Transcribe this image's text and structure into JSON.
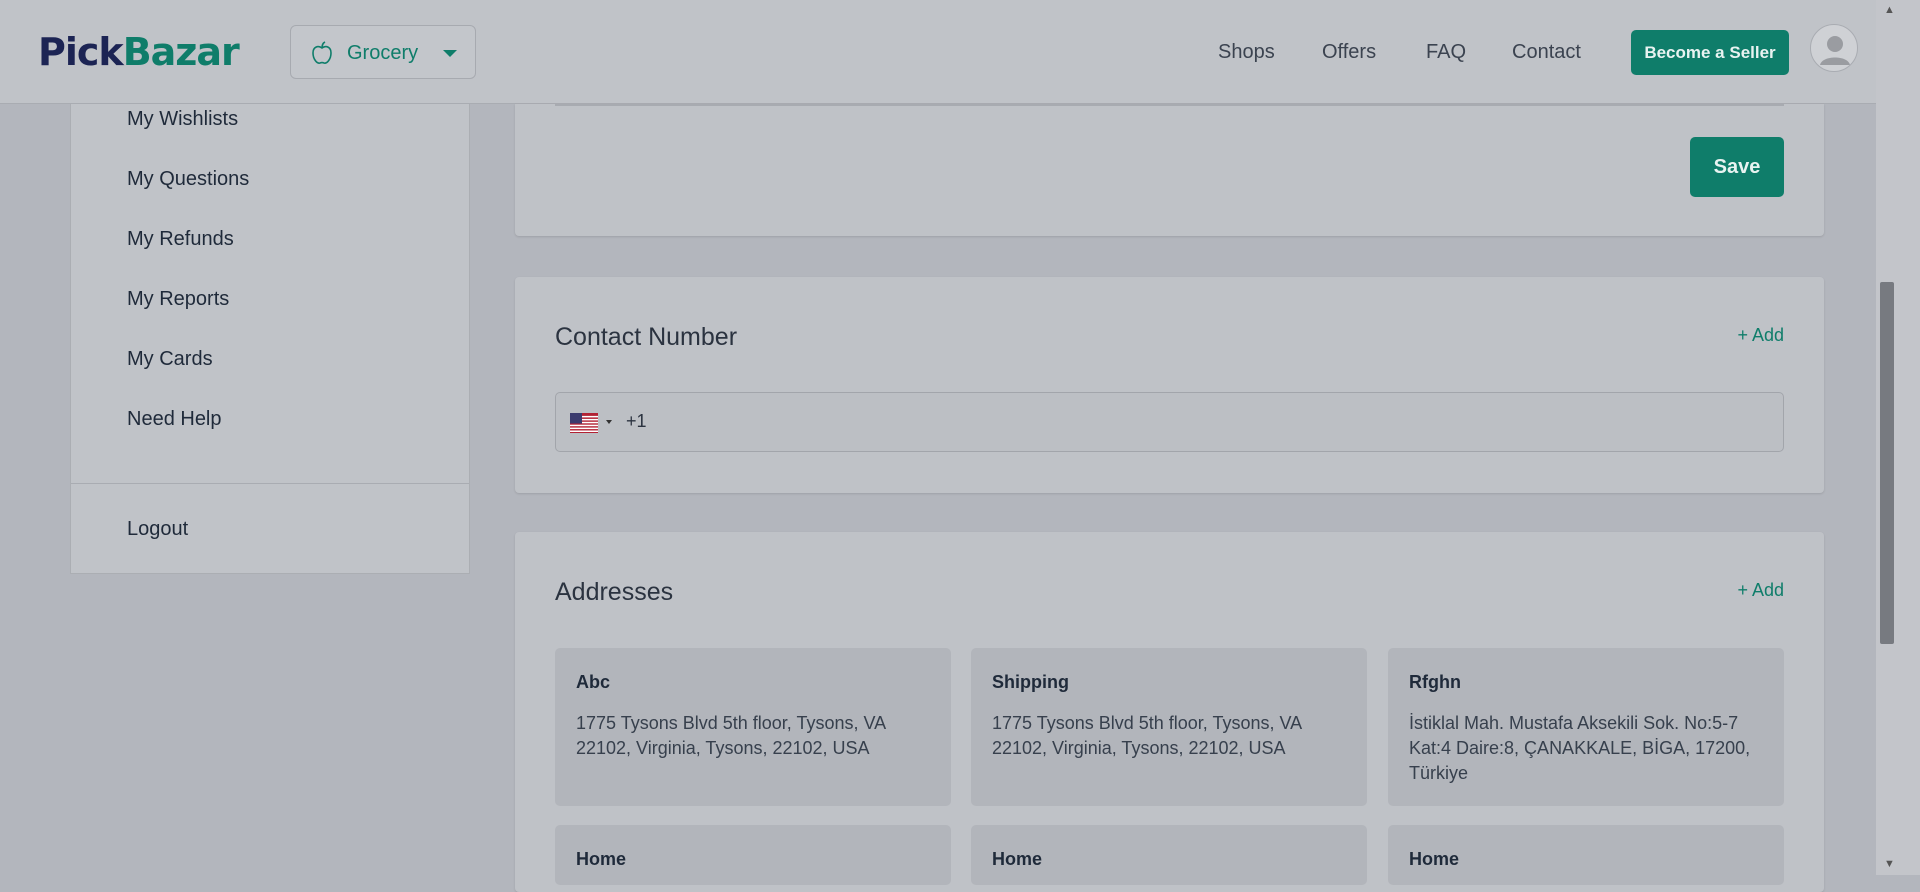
{
  "header": {
    "logo_part1": "Pick",
    "logo_part2": "Bazar",
    "category": "Grocery",
    "nav": [
      "Shops",
      "Offers",
      "FAQ",
      "Contact"
    ],
    "seller_button": "Become a Seller"
  },
  "sidebar": {
    "items": [
      "My Wishlists",
      "My Questions",
      "My Refunds",
      "My Reports",
      "My Cards",
      "Need Help"
    ],
    "logout": "Logout"
  },
  "profile": {
    "save_label": "Save"
  },
  "contact": {
    "title": "Contact Number",
    "add_label": "+ Add",
    "country_code": "+1"
  },
  "addresses": {
    "title": "Addresses",
    "add_label": "+ Add",
    "items": [
      {
        "title": "Abc",
        "text": "1775 Tysons Blvd 5th floor, Tysons, VA 22102, Virginia, Tysons, 22102, USA"
      },
      {
        "title": "Shipping",
        "text": "1775 Tysons Blvd 5th floor, Tysons, VA 22102, Virginia, Tysons, 22102, USA"
      },
      {
        "title": "Rfghn",
        "text": "İstiklal Mah. Mustafa Aksekili Sok. No:5-7 Kat:4 Daire:8, ÇANAKKALE, BİGA, 17200, Türkiye"
      },
      {
        "title": "Home",
        "text": ""
      },
      {
        "title": "Home",
        "text": ""
      },
      {
        "title": "Home",
        "text": ""
      }
    ]
  },
  "colors": {
    "accent": "#0f7d6a",
    "logo_dark": "#1c2454"
  }
}
